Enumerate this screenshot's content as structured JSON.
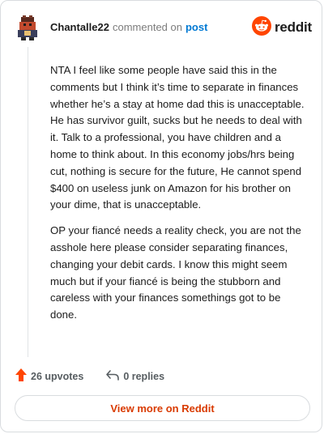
{
  "header": {
    "author": "Chantalle22",
    "action": "commented on",
    "post_link": "post",
    "brand": "reddit"
  },
  "comment": {
    "paragraphs": [
      "NTA I feel like some people have said this in the comments but I think it’s time to separate in finances whether he’s a stay at home dad this is unacceptable. He has survivor guilt, sucks but he needs to deal with it. Talk to a professional, you have children and a home to think about. In this economy jobs/hrs being cut, nothing is secure for the future, He cannot spend $400 on useless junk on Amazon for his brother on your dime, that is unacceptable.",
      "OP your fiancé needs a reality check, you are not the asshole here please consider separating finances, changing your debit cards. I know this might seem much but if your fiancé is being the stubborn and careless with your finances somethings got to be done."
    ]
  },
  "footer": {
    "upvotes": "26 upvotes",
    "replies": "0 replies",
    "view_more": "View more on Reddit"
  },
  "colors": {
    "accent": "#ff4500",
    "link": "#0079d3",
    "view_more_text": "#d93a00"
  },
  "icons": {
    "avatar": "avatar",
    "logo": "reddit-snoo-icon",
    "upvote": "upvote-arrow-icon",
    "reply": "reply-arrow-icon"
  }
}
